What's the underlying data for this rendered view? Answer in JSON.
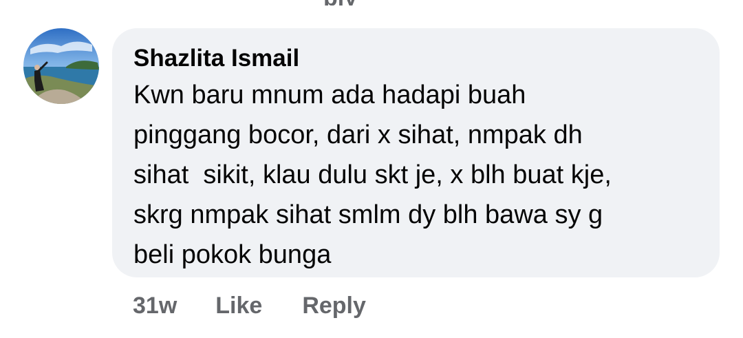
{
  "top_partial_text": "ply",
  "comment": {
    "author": "Shazlita Ismail",
    "text": "Kwn baru mnum ada hadapi buah\npinggang bocor, dari x sihat, nmpak dh\nsihat  sikit, klau dulu skt je, x blh buat kje,\nskrg nmpak sihat smlm dy blh bawa sy g\nbeli pokok bunga",
    "timestamp": "31w",
    "like_label": "Like",
    "reply_label": "Reply"
  },
  "colors": {
    "bubble_background": "#f0f2f5",
    "action_text": "#65676b",
    "primary_text": "#050505"
  }
}
